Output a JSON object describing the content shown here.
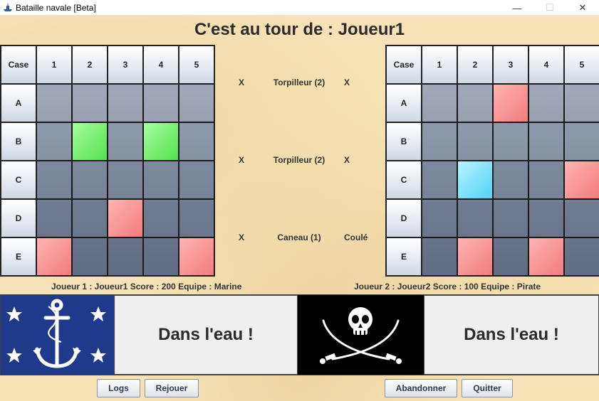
{
  "window": {
    "title": "Bataille navale [Beta]",
    "minimize": "—",
    "maximize": "☐",
    "close": "✕"
  },
  "turn_title": "C'est au tour de : Joueur1",
  "grid_headers": {
    "corner": "Case",
    "cols": [
      "1",
      "2",
      "3",
      "4",
      "5"
    ],
    "rows": [
      "A",
      "B",
      "C",
      "D",
      "E"
    ]
  },
  "left_grid": [
    [
      "sea",
      "sea",
      "sea",
      "sea",
      "sea"
    ],
    [
      "sea",
      "ship",
      "sea",
      "ship",
      "sea"
    ],
    [
      "sea",
      "sea",
      "sea",
      "sea",
      "sea"
    ],
    [
      "sea",
      "sea",
      "hit",
      "sea",
      "sea"
    ],
    [
      "hit",
      "sea",
      "sea",
      "sea",
      "hit"
    ]
  ],
  "right_grid": [
    [
      "sea",
      "sea",
      "hit",
      "sea",
      "sea"
    ],
    [
      "sea",
      "sea",
      "sea",
      "sea",
      "sea"
    ],
    [
      "sea",
      "miss",
      "sea",
      "sea",
      "hit"
    ],
    [
      "sea",
      "sea",
      "sea",
      "sea",
      "sea"
    ],
    [
      "sea",
      "hit",
      "sea",
      "hit",
      "sea"
    ]
  ],
  "ships": [
    {
      "left": "X",
      "name": "Torpilleur (2)",
      "right": "X"
    },
    {
      "left": "X",
      "name": "Torpilleur (2)",
      "right": "X"
    },
    {
      "left": "X",
      "name": "Caneau (1)",
      "right": "Coulé"
    }
  ],
  "player1": {
    "info": "Joueur 1 :  Joueur1  Score :  200  Equipe :  Marine"
  },
  "player2": {
    "info": "Joueur 2 :  Joueur2  Score :  100  Equipe :  Pirate"
  },
  "messages": {
    "player1": "Dans l'eau !",
    "player2": "Dans l'eau !"
  },
  "buttons": {
    "logs": "Logs",
    "replay": "Rejouer",
    "abandon": "Abandonner",
    "quit": "Quitter"
  },
  "colors": {
    "marine_flag": "#1f3a8a",
    "pirate_flag": "#000000",
    "hit": "#f27c7c",
    "ship": "#55e04f",
    "miss": "#4fd3f5"
  },
  "icons": {
    "marine": "anchor-stars-icon",
    "pirate": "skull-crossed-swords-icon"
  }
}
